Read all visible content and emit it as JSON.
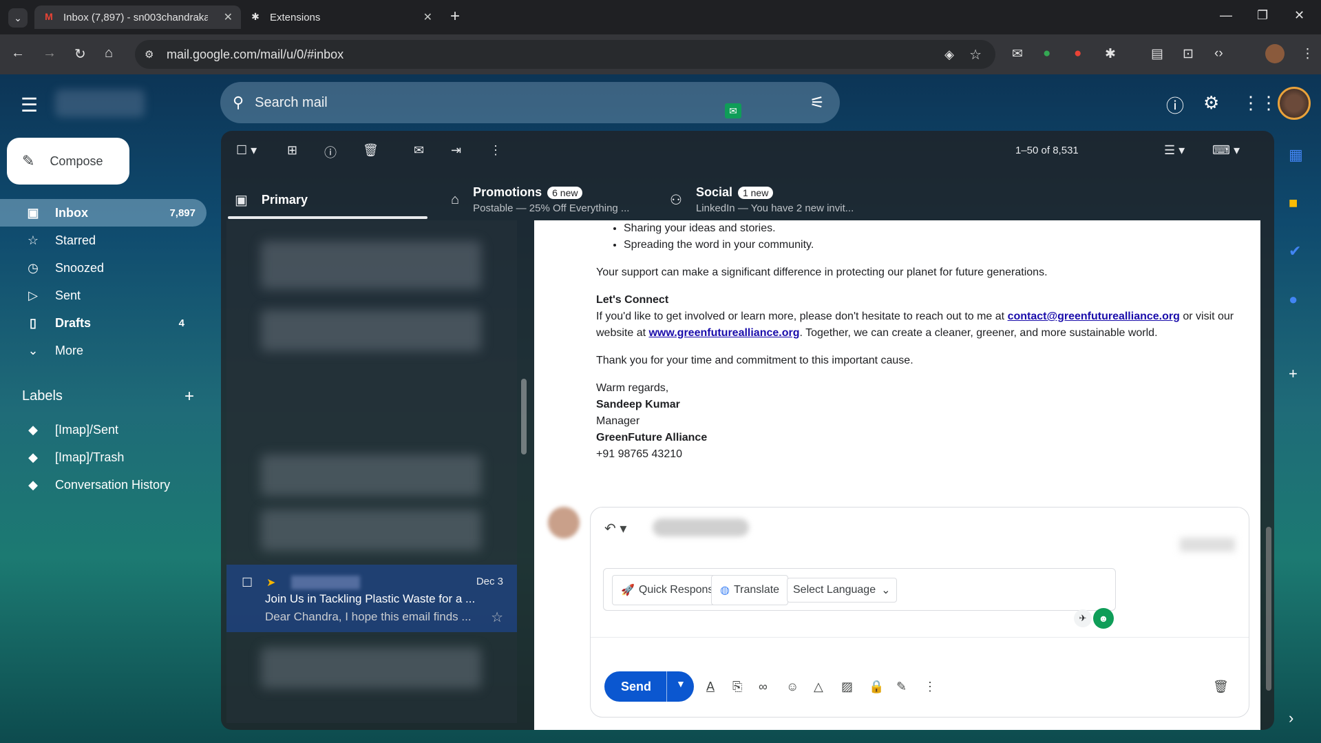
{
  "browser": {
    "tabs": [
      {
        "title": "Inbox (7,897) - sn003chandraka",
        "icon": "gmail-icon",
        "active": true
      },
      {
        "title": "Extensions",
        "icon": "puzzle-icon",
        "active": false
      }
    ],
    "url": "mail.google.com/mail/u/0/#inbox"
  },
  "gmail": {
    "search_placeholder": "Search mail",
    "compose_label": "Compose",
    "nav": [
      {
        "label": "Inbox",
        "count": "7,897",
        "icon": "inbox-icon"
      },
      {
        "label": "Starred",
        "count": "",
        "icon": "star-icon"
      },
      {
        "label": "Snoozed",
        "count": "",
        "icon": "clock-icon"
      },
      {
        "label": "Sent",
        "count": "",
        "icon": "send-icon"
      },
      {
        "label": "Drafts",
        "count": "4",
        "icon": "draft-icon"
      },
      {
        "label": "More",
        "count": "",
        "icon": "chevron-down-icon"
      }
    ],
    "labels_heading": "Labels",
    "labels": [
      "[Imap]/Sent",
      "[Imap]/Trash",
      "Conversation History"
    ],
    "pager": "1–50 of 8,531",
    "category_tabs": [
      {
        "title": "Primary",
        "badge": "",
        "subtitle": ""
      },
      {
        "title": "Promotions",
        "badge": "6 new",
        "subtitle": "Postable — 25% Off Everything ..."
      },
      {
        "title": "Social",
        "badge": "1 new",
        "subtitle": "LinkedIn — You have 2 new invit..."
      }
    ],
    "selected_mail": {
      "date": "Dec 3",
      "subject": "Join Us in Tackling Plastic Waste for a ...",
      "snippet": "Dear Chandra, I hope this email finds ..."
    }
  },
  "email": {
    "bullets": [
      "Sharing your ideas and stories.",
      "Spreading the word in your community."
    ],
    "support_line": "Your support can make a significant difference in protecting our planet for future generations.",
    "connect_heading": "Let's Connect",
    "connect_pre": "If you'd like to get involved or learn more, please don't hesitate to reach out to me at ",
    "connect_email": "contact@greenfuturealliance.org",
    "connect_mid": " or visit our website at ",
    "connect_site": "www.greenfuturealliance.org",
    "connect_post": ". Together, we can create a cleaner, greener, and more sustainable world.",
    "thanks": "Thank you for your time and commitment to this important cause.",
    "regards": "Warm regards,",
    "sender_name": "Sandeep Kumar",
    "sender_title": "Manager",
    "sender_org": "GreenFuture Alliance",
    "sender_phone": "+91 98765 43210"
  },
  "reply": {
    "quick_response": "Quick Response",
    "translate": "Translate",
    "select_language": "Select Language",
    "send": "Send"
  }
}
